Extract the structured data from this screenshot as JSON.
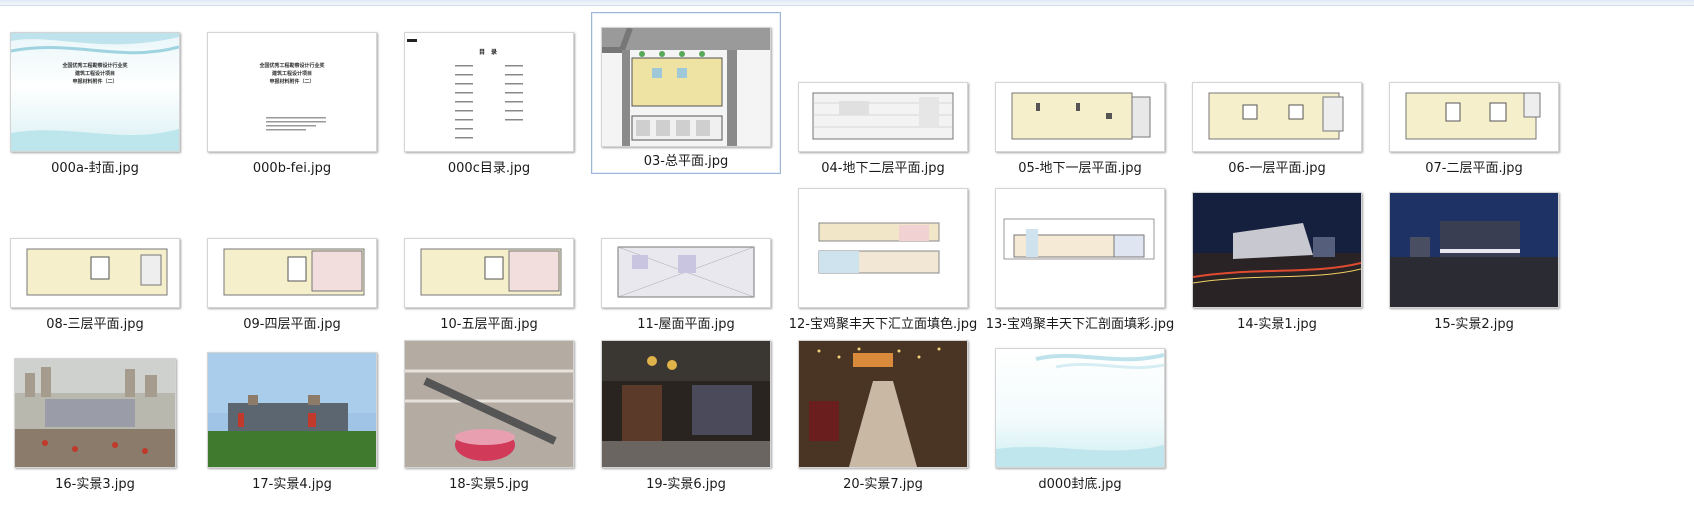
{
  "files": [
    {
      "name": "000a-封面.jpg"
    },
    {
      "name": "000b-fei.jpg"
    },
    {
      "name": "000c目录.jpg"
    },
    {
      "name": "03-总平面.jpg"
    },
    {
      "name": "04-地下二层平面.jpg"
    },
    {
      "name": "05-地下一层平面.jpg"
    },
    {
      "name": "06-一层平面.jpg"
    },
    {
      "name": "07-二层平面.jpg"
    },
    {
      "name": "08-三层平面.jpg"
    },
    {
      "name": "09-四层平面.jpg"
    },
    {
      "name": "10-五层平面.jpg"
    },
    {
      "name": "11-屋面平面.jpg"
    },
    {
      "name": "12-宝鸡聚丰天下汇立面填色.jpg"
    },
    {
      "name": "13-宝鸡聚丰天下汇剖面填彩.jpg"
    },
    {
      "name": "14-实景1.jpg"
    },
    {
      "name": "15-实景2.jpg"
    },
    {
      "name": "16-实景3.jpg"
    },
    {
      "name": "17-实景4.jpg"
    },
    {
      "name": "18-实景5.jpg"
    },
    {
      "name": "19-实景6.jpg"
    },
    {
      "name": "20-实景7.jpg"
    },
    {
      "name": "d000封底.jpg"
    }
  ],
  "cover": {
    "line1": "全国优秀工程勘察设计行业奖",
    "line2": "建筑工程设计项目",
    "line3": "申报材料附件（二）"
  },
  "toc": {
    "title": "目  录"
  }
}
